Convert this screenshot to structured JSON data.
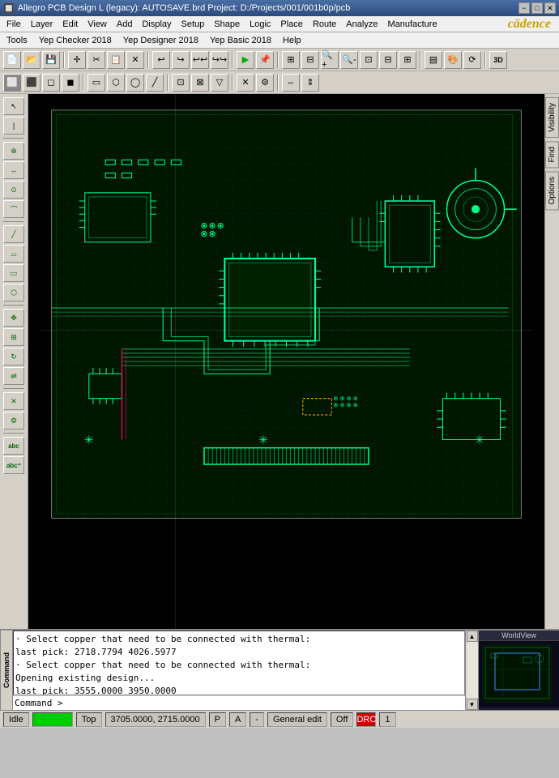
{
  "titleBar": {
    "icon": "📐",
    "title": "Allegro PCB Design L (legacy): AUTOSAVE.brd  Project: D:/Projects/001/001b0p/pcb",
    "controls": {
      "minimize": "−",
      "maximize": "□",
      "close": "✕"
    }
  },
  "menuBar": {
    "items": [
      "File",
      "Layer",
      "Edit",
      "View",
      "Add",
      "Display",
      "Setup",
      "Shape",
      "Logic",
      "Place",
      "Route",
      "Analyze",
      "Manufacture"
    ]
  },
  "toolsBar": {
    "items": [
      "Tools",
      "Yep Checker 2018",
      "Yep Designer 2018",
      "Yep Basic 2018",
      "Help"
    ]
  },
  "cadenceLogo": "cādence",
  "toolbar1": {
    "buttons": [
      "📂",
      "💾",
      "✂",
      "📋",
      "↩",
      "↪",
      "▶",
      "◾",
      "🔍",
      "+",
      "-",
      "⟳",
      "⬜",
      "⬛",
      "📊",
      "3D"
    ]
  },
  "toolbar2": {
    "buttons": [
      "⬜",
      "⬛",
      "◻",
      "◼",
      "▭",
      "▬",
      "◯",
      "△",
      "⬡",
      "✕",
      "⛶",
      "⇔",
      "⇕"
    ]
  },
  "leftToolbar": {
    "groups": [
      [
        "↖",
        "✏",
        "⊕",
        "⊠"
      ],
      [
        "→",
        "↗",
        "↕",
        "↻"
      ],
      [
        "🔲",
        "⊞",
        "⊟",
        "⊕"
      ],
      [
        "abc",
        "abc⁺"
      ]
    ]
  },
  "rightPanel": {
    "tabs": [
      "Visibility",
      "Find",
      "Options"
    ]
  },
  "console": {
    "lines": [
      "· Select copper that need to be connected with thermal:",
      "last pick:  2718.7794 4026.5977",
      "· Select copper that need to be connected with thermal:",
      "Opening existing design...",
      "last pick:  3555.0000 3950.0000"
    ],
    "prompt": "Command >"
  },
  "miniMap": {
    "label": "WorldView"
  },
  "statusBar": {
    "idle": "Idle",
    "status": "",
    "layer": "Top",
    "coords": "3705.0000, 2715.0000",
    "mode1": "P",
    "mode2": "A",
    "separator": "-",
    "editMode": "General edit",
    "off": "Off",
    "drc": "DRC",
    "number": "1"
  }
}
